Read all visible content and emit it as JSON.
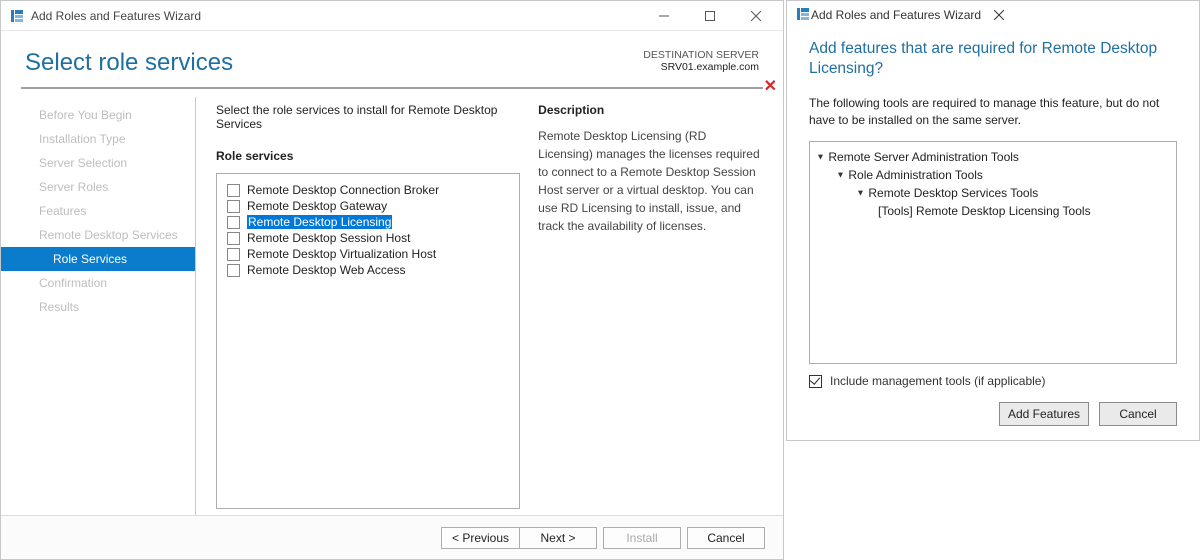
{
  "main_window": {
    "title": "Add Roles and Features Wizard",
    "heading": "Select role services",
    "destination_label": "DESTINATION SERVER",
    "destination_server": "SRV01.example.com",
    "instruction": "Select the role services to install for Remote Desktop Services",
    "nav": [
      {
        "label": "Before You Begin",
        "active": false,
        "sub": false
      },
      {
        "label": "Installation Type",
        "active": false,
        "sub": false
      },
      {
        "label": "Server Selection",
        "active": false,
        "sub": false
      },
      {
        "label": "Server Roles",
        "active": false,
        "sub": false
      },
      {
        "label": "Features",
        "active": false,
        "sub": false
      },
      {
        "label": "Remote Desktop Services",
        "active": false,
        "sub": false
      },
      {
        "label": "Role Services",
        "active": true,
        "sub": true
      },
      {
        "label": "Confirmation",
        "active": false,
        "sub": false
      },
      {
        "label": "Results",
        "active": false,
        "sub": false
      }
    ],
    "services_label": "Role services",
    "services": [
      {
        "label": "Remote Desktop Connection Broker",
        "checked": false,
        "selected": false
      },
      {
        "label": "Remote Desktop Gateway",
        "checked": false,
        "selected": false
      },
      {
        "label": "Remote Desktop Licensing",
        "checked": false,
        "selected": true
      },
      {
        "label": "Remote Desktop Session Host",
        "checked": false,
        "selected": false
      },
      {
        "label": "Remote Desktop Virtualization Host",
        "checked": false,
        "selected": false
      },
      {
        "label": "Remote Desktop Web Access",
        "checked": false,
        "selected": false
      }
    ],
    "description_label": "Description",
    "description_text": "Remote Desktop Licensing (RD Licensing) manages the licenses required to connect to a Remote Desktop Session Host server or a virtual desktop. You can use RD Licensing to install, issue, and track the availability of licenses.",
    "buttons": {
      "previous": "< Previous",
      "next": "Next >",
      "install": "Install",
      "cancel": "Cancel"
    }
  },
  "dialog": {
    "title": "Add Roles and Features Wizard",
    "heading": "Add features that are required for Remote Desktop Licensing?",
    "info": "The following tools are required to manage this feature, but do not have to be installed on the same server.",
    "tree": [
      {
        "indent": 0,
        "expander": true,
        "label": "Remote Server Administration Tools"
      },
      {
        "indent": 1,
        "expander": true,
        "label": "Role Administration Tools"
      },
      {
        "indent": 2,
        "expander": true,
        "label": "Remote Desktop Services Tools"
      },
      {
        "indent": 3,
        "expander": false,
        "label": "[Tools] Remote Desktop Licensing Tools"
      }
    ],
    "include_mgmt_label": "Include management tools (if applicable)",
    "include_mgmt_checked": true,
    "buttons": {
      "add": "Add Features",
      "cancel": "Cancel"
    }
  }
}
